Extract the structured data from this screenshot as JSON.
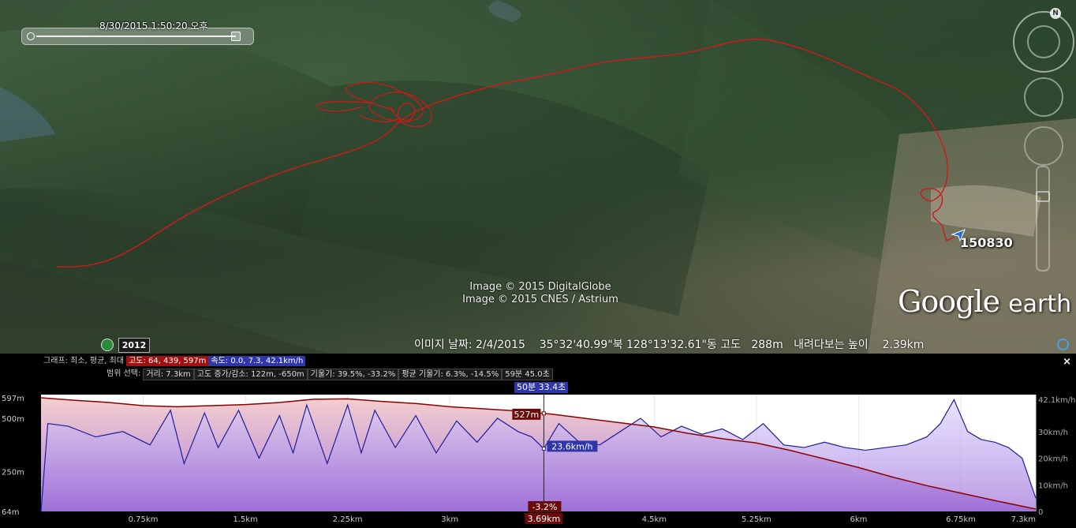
{
  "app": {
    "name": "Google earth"
  },
  "viewport": {
    "timestamp": "8/30/2015   1:50:20 오후",
    "credit_line1": "Image © 2015 DigitalGlobe",
    "credit_line2": "Image © 2015 CNES / Astrium",
    "placemark_label": "150830",
    "logo_text_1": "Google",
    "logo_text_2": "earth",
    "compass_north": "N",
    "status_text": "이미지 날짜: 2/4/2015    35°32'40.99\"북 128°13'32.61\"동 고도   288m   내려다보는 높이    2.39km",
    "year_badge": "2012",
    "track_color": "#d01818"
  },
  "profile": {
    "close_label": "×",
    "stats_label": "그래프: 최소, 평균, 최대",
    "elevation_chip": "고도: 64, 439, 597m",
    "speed_chip": "속도: 0.0, 7.3, 42.1km/h",
    "range_label": "범위 선택:",
    "distance_chip": "거리: 7.3km",
    "gain_chip": "고도 증가/감소: 122m, -650m",
    "slope_chip": "기울기: 39.5%, -33.2%",
    "avg_slope_chip": "평균 기울기: 6.3%, -14.5%",
    "time_chip": "59분 45.0초",
    "cursor_duration": "50분 33.4초",
    "cursor_elevation": "527m",
    "cursor_speed": "23.6km/h",
    "cursor_slope": "-3.2%",
    "cursor_distance": "3.69km",
    "colors": {
      "elevation": "#8b0000",
      "speed": "#1e1e9a",
      "fill_top": "#f3c9c9",
      "fill_bottom": "#a070d8"
    }
  },
  "chart_data": {
    "type": "line",
    "x_unit": "km",
    "x_range": [
      0,
      7.3
    ],
    "x_ticks": [
      "0.75km",
      "1.5km",
      "2.25km",
      "3km",
      "4.5km",
      "5.25km",
      "6km",
      "6.75km",
      "7.3km"
    ],
    "x_tick_values": [
      0.75,
      1.5,
      2.25,
      3,
      4.5,
      5.25,
      6,
      6.75,
      7.3
    ],
    "y_left_ticks": [
      "597m",
      "500m",
      "250m",
      "64m"
    ],
    "y_left_values": [
      597,
      500,
      250,
      64
    ],
    "y_left_range": [
      64,
      597
    ],
    "y_right_ticks": [
      "42.1km/h",
      "30km/h",
      "20km/h",
      "10km/h",
      "0"
    ],
    "y_right_values": [
      42.1,
      30,
      20,
      10,
      0
    ],
    "y_right_range": [
      0,
      42.1
    ],
    "cursor_x": 3.69,
    "series": [
      {
        "name": "고도",
        "x": [
          0,
          0.25,
          0.5,
          0.75,
          1.0,
          1.25,
          1.5,
          1.75,
          2.0,
          2.25,
          2.5,
          2.75,
          3.0,
          3.25,
          3.5,
          3.75,
          4.0,
          4.25,
          4.5,
          4.75,
          5.0,
          5.25,
          5.5,
          5.75,
          6.0,
          6.25,
          6.5,
          6.75,
          7.0,
          7.3
        ],
        "values": [
          597,
          585,
          575,
          560,
          555,
          560,
          565,
          575,
          590,
          592,
          580,
          570,
          555,
          545,
          535,
          520,
          500,
          480,
          460,
          430,
          405,
          385,
          350,
          310,
          270,
          225,
          185,
          150,
          115,
          75
        ]
      },
      {
        "name": "속도",
        "x": [
          0,
          0.05,
          0.2,
          0.4,
          0.6,
          0.8,
          0.95,
          1.05,
          1.2,
          1.3,
          1.45,
          1.6,
          1.75,
          1.85,
          1.95,
          2.1,
          2.25,
          2.35,
          2.45,
          2.6,
          2.75,
          2.9,
          3.05,
          3.2,
          3.35,
          3.5,
          3.6,
          3.69,
          3.8,
          3.95,
          4.1,
          4.25,
          4.4,
          4.55,
          4.7,
          4.85,
          5.0,
          5.15,
          5.3,
          5.45,
          5.6,
          5.75,
          5.9,
          6.05,
          6.2,
          6.35,
          6.5,
          6.6,
          6.7,
          6.8,
          6.9,
          7.0,
          7.1,
          7.2,
          7.3
        ],
        "values": [
          0,
          33,
          32,
          28,
          30,
          25,
          38,
          18,
          37,
          24,
          38,
          20,
          36,
          22,
          40,
          18,
          40,
          22,
          38,
          24,
          36,
          22,
          34,
          26,
          35,
          30,
          28,
          23.6,
          33,
          26,
          25,
          30,
          35,
          28,
          32,
          29,
          31,
          27,
          33,
          25,
          24,
          26,
          24,
          23,
          24,
          25,
          28,
          33,
          42,
          30,
          27,
          26,
          24,
          20,
          5
        ]
      }
    ]
  }
}
